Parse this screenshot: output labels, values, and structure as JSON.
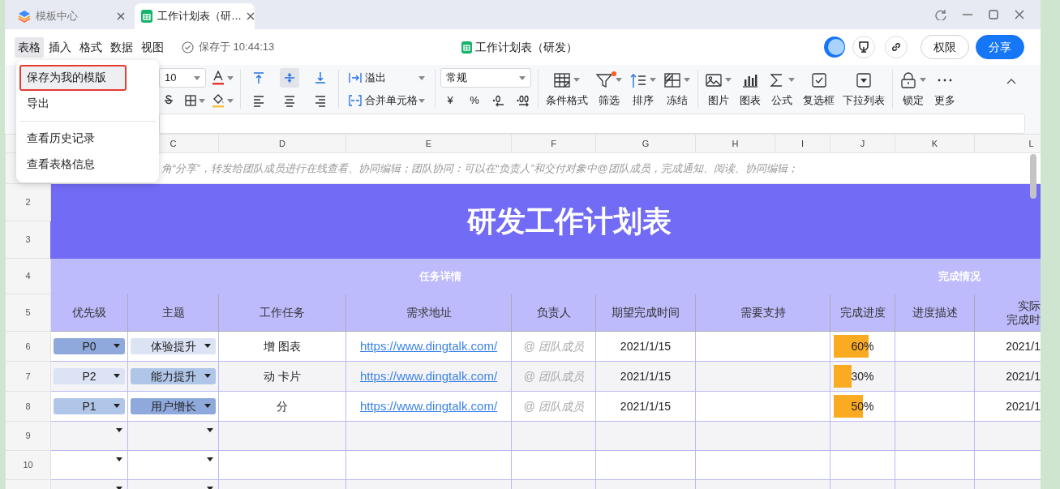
{
  "tabs": [
    {
      "title": "模板中心",
      "selected": false
    },
    {
      "title": "工作计划表（研…",
      "selected": true
    }
  ],
  "menu": [
    {
      "label": "表格",
      "selected": true
    },
    {
      "label": "插入",
      "selected": false
    },
    {
      "label": "格式",
      "selected": false
    },
    {
      "label": "数据",
      "selected": false
    },
    {
      "label": "视图",
      "selected": false
    }
  ],
  "save_status": "保存于 10:44:13",
  "doc_title": "工作计划表（研发）",
  "header_buttons": [
    {
      "label": "权限",
      "kind": "outline"
    },
    {
      "label": "分享",
      "kind": "primary"
    }
  ],
  "toolbar": {
    "font_size": "10",
    "vertical_align": [
      {
        "selected": false
      },
      {
        "selected": true
      },
      {
        "selected": false
      }
    ],
    "wrap_mode": "溢出",
    "merge_label": "合并单元格",
    "number_format": "常规",
    "currency": "¥",
    "percent": "%",
    "tools": [
      {
        "label": "条件格式",
        "has_menu": true,
        "dot": false
      },
      {
        "label": "筛选",
        "has_menu": true,
        "dot": true
      },
      {
        "label": "排序",
        "has_menu": true,
        "dot": false
      },
      {
        "label": "冻结",
        "has_menu": true,
        "dot": false
      },
      {
        "label": "图片",
        "has_menu": true,
        "dot": false
      },
      {
        "label": "图表",
        "has_menu": false,
        "dot": false
      },
      {
        "label": "公式",
        "has_menu": true,
        "dot": false
      },
      {
        "label": "复选框",
        "has_menu": false,
        "dot": false
      },
      {
        "label": "下拉列表",
        "has_menu": false,
        "dot": false
      },
      {
        "label": "锁定",
        "has_menu": true,
        "dot": false
      },
      {
        "label": "更多",
        "has_menu": false,
        "dot": false
      }
    ]
  },
  "dropdown": {
    "groups": [
      [
        {
          "label": "保存为我的模版",
          "selected": true,
          "annotated": true
        },
        {
          "label": "导出",
          "selected": false,
          "annotated": false
        }
      ],
      [
        {
          "label": "查看历史记录",
          "selected": false,
          "annotated": false
        },
        {
          "label": "查看表格信息",
          "selected": false,
          "annotated": false
        }
      ]
    ]
  },
  "sheet": {
    "column_letters": [
      "C",
      "D",
      "E",
      "F",
      "G",
      "H",
      "I",
      "J",
      "K",
      "L"
    ],
    "note": "角“分享”，转发给团队成员进行在线查看、协同编辑；团队协同：可以在“负责人”和交付对象中@团队成员，完成通知、阅读、协同编辑；",
    "title_row_numbers": [
      "2",
      "3"
    ],
    "title": "研发工作计划表",
    "section_row_number": "4",
    "sections": [
      "任务详情",
      "完成情况"
    ],
    "header_row_number": "5",
    "headers": [
      "优先级",
      "主题",
      "工作任务",
      "需求地址",
      "负责人",
      "期望完成时间",
      "需要支持",
      "完成进度",
      "进度描述",
      [
        "实际",
        "完成时"
      ]
    ],
    "rows": [
      {
        "row_number": "6",
        "priority": {
          "label": "P0",
          "color": "#8fa9dc"
        },
        "topic": {
          "label": "体验提升",
          "color": "#dce3f5"
        },
        "task": "增 图表",
        "link": "https://www.dingtalk.com/",
        "owner": "@ 团队成员",
        "due": "2021/1/15",
        "progress": {
          "level": 0.6,
          "reading": "60%"
        },
        "actual": "2021/1"
      },
      {
        "row_number": "7",
        "priority": {
          "label": "P2",
          "color": "#dce3f5"
        },
        "topic": {
          "label": "能力提升",
          "color": "#b0c6e8"
        },
        "task": "动 卡片",
        "link": "https://www.dingtalk.com/",
        "owner": "@ 团队成员",
        "due": "2021/1/15",
        "progress": {
          "level": 0.3,
          "reading": "30%"
        },
        "actual": "2021/1"
      },
      {
        "row_number": "8",
        "priority": {
          "label": "P1",
          "color": "#b0c6e8"
        },
        "topic": {
          "label": "用户增长",
          "color": "#8fa9dc"
        },
        "task": "分",
        "link": "https://www.dingtalk.com/",
        "owner": "@ 团队成员",
        "due": "2021/1/15",
        "progress": {
          "level": 0.5,
          "reading": "50%"
        },
        "actual": "2021/1"
      },
      {
        "row_number": "9"
      },
      {
        "row_number": "10"
      }
    ]
  }
}
